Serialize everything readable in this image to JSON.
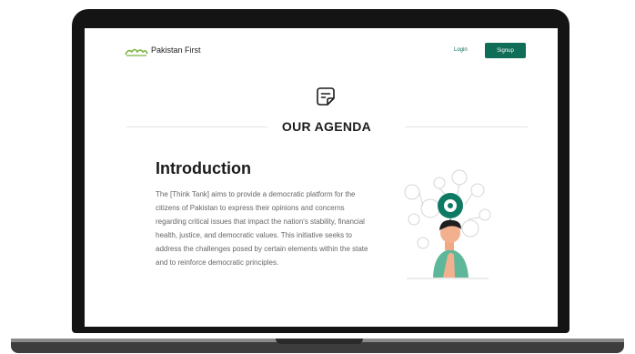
{
  "nav": {
    "brand": "Pakistan First",
    "login": "Login",
    "signup": "Signup"
  },
  "section": {
    "title": "OUR AGENDA",
    "icon": "document-edit-icon"
  },
  "intro": {
    "heading": "Introduction",
    "body": "The [Think Tank] aims to provide a democratic platform for the citizens of Pakistan to express their opinions and concerns regarding critical issues that impact the nation's stability, financial health, justice, and democratic values. This initiative seeks to address the challenges posed by certain elements within the state and to reinforce democratic principles."
  },
  "colors": {
    "accent": "#0f6d58",
    "logo": "#7cb342"
  }
}
